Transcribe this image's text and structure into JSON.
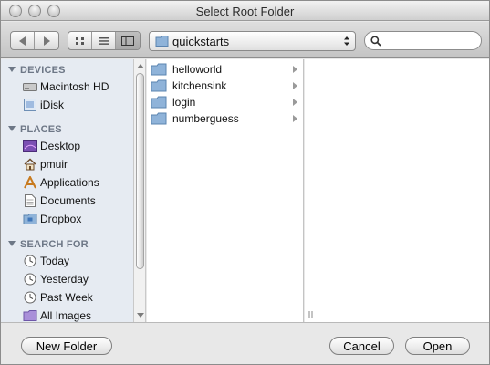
{
  "window": {
    "title": "Select Root Folder"
  },
  "path_popup": {
    "value": "quickstarts"
  },
  "search": {
    "placeholder": "",
    "value": ""
  },
  "sidebar": {
    "sections": [
      {
        "title": "DEVICES",
        "items": [
          {
            "label": "Macintosh HD",
            "icon": "hard-drive-icon"
          },
          {
            "label": "iDisk",
            "icon": "idisk-icon"
          }
        ]
      },
      {
        "title": "PLACES",
        "items": [
          {
            "label": "Desktop",
            "icon": "desktop-icon"
          },
          {
            "label": "pmuir",
            "icon": "home-icon"
          },
          {
            "label": "Applications",
            "icon": "applications-icon"
          },
          {
            "label": "Documents",
            "icon": "documents-icon"
          },
          {
            "label": "Dropbox",
            "icon": "dropbox-folder-icon"
          }
        ]
      },
      {
        "title": "SEARCH FOR",
        "items": [
          {
            "label": "Today",
            "icon": "clock-icon"
          },
          {
            "label": "Yesterday",
            "icon": "clock-icon"
          },
          {
            "label": "Past Week",
            "icon": "clock-icon"
          },
          {
            "label": "All Images",
            "icon": "images-folder-icon"
          }
        ]
      }
    ]
  },
  "browser": {
    "column1": [
      {
        "name": "helloworld"
      },
      {
        "name": "kitchensink"
      },
      {
        "name": "login"
      },
      {
        "name": "numberguess"
      }
    ]
  },
  "buttons": {
    "new_folder": "New Folder",
    "cancel": "Cancel",
    "open": "Open"
  },
  "colors": {
    "sidebar_bg": "#e6ebf2",
    "section_header": "#6d7786",
    "folder_blue": "#7ea7cf"
  }
}
